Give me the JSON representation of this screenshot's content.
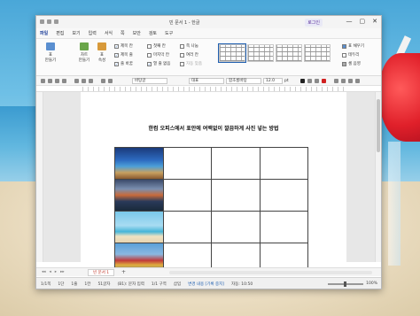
{
  "window": {
    "title": "빈 문서 1 - 한글",
    "login": "로그인",
    "controls": [
      "—",
      "▢",
      "✕"
    ]
  },
  "menu": {
    "file": "파일",
    "items": [
      "편집",
      "보기",
      "입력",
      "서식",
      "쪽",
      "보안",
      "검토",
      "도구"
    ]
  },
  "ribbon": {
    "table_btn": "표\n만들기",
    "chart_btn": "차트\n만들기",
    "prop_btn": "표\n속성",
    "checks": [
      {
        "label": "제목 칸",
        "checked": true
      },
      {
        "label": "제목 줄",
        "checked": true
      },
      {
        "label": "줄 바꿈",
        "checked": true
      },
      {
        "label": "첫째 칸",
        "checked": false
      },
      {
        "label": "마지막 칸",
        "checked": false
      },
      {
        "label": "열 줄 없음",
        "checked": true
      }
    ],
    "checks2": [
      {
        "label": "쪽 나눔",
        "checked": false
      },
      {
        "label": "여러 칸",
        "checked": false
      },
      {
        "label": "자동 맞춤",
        "checked": false
      }
    ],
    "right_items": [
      "표 채우기",
      "테두리",
      "셀 음영"
    ]
  },
  "format": {
    "style": "바탕글",
    "lang": "대표",
    "font": "함초롬바탕",
    "size": "12.0",
    "unit": "pt"
  },
  "document": {
    "title": "한컴 오피스에서 표안에 여백없이 깔끔하게 사진 넣는 방법",
    "table": {
      "rows": 4,
      "cols": 4
    }
  },
  "tabs": {
    "doc_tab": "빈 문서 1",
    "add": "+"
  },
  "status": {
    "page": "1/1쪽",
    "section": "1단",
    "line": "1줄",
    "col": "1칸",
    "chars": "51글자",
    "position": "(B1): 문자 입력",
    "cell": "1/1 구역",
    "mode": "삽입",
    "changes": "변경 내용 [기록 중지]",
    "note": "자동: 10:50",
    "zoom": "100%"
  }
}
